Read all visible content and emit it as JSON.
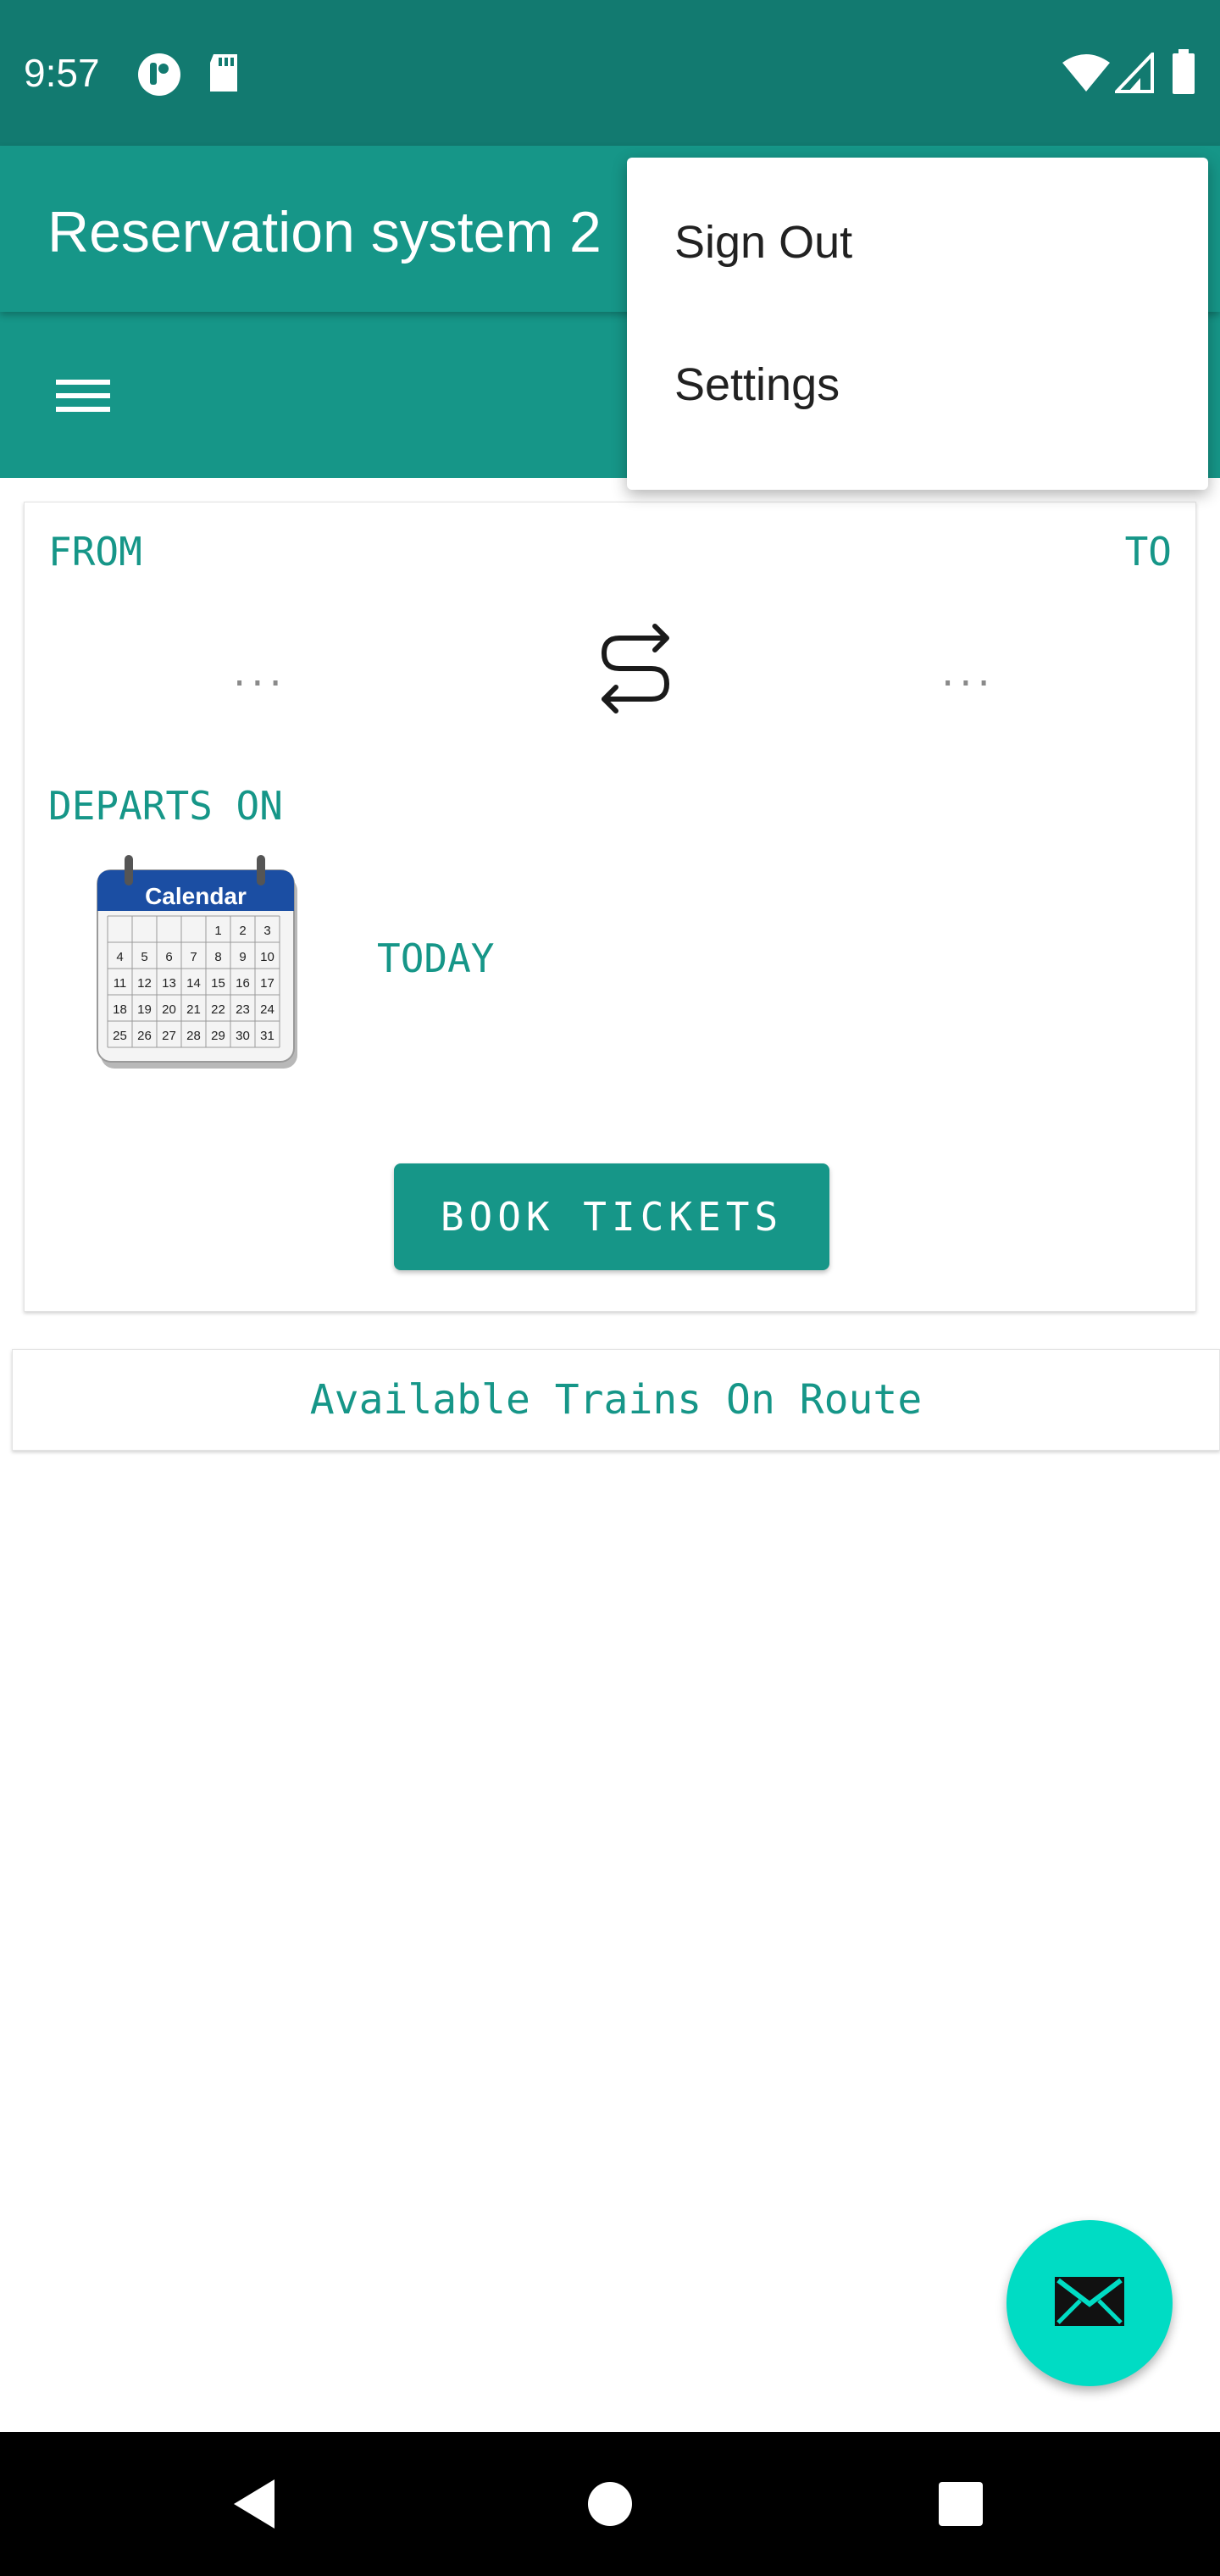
{
  "status_bar": {
    "time": "9:57",
    "icons": [
      "notification-app-icon",
      "sd-card-icon",
      "wifi-icon",
      "cell-signal-icon",
      "battery-icon"
    ]
  },
  "app_bar": {
    "title": "Reservation system 2"
  },
  "toolbar": {
    "menu_icon": "hamburger-menu-icon"
  },
  "overflow_menu": {
    "items": [
      {
        "label": "Sign Out"
      },
      {
        "label": "Settings"
      }
    ]
  },
  "booking_card": {
    "from_label": "FROM",
    "to_label": "TO",
    "from_value": "...",
    "to_value": "...",
    "swap_icon": "swap-route-icon",
    "departs_label": "DEPARTS ON",
    "calendar_icon": "calendar-icon",
    "calendar_caption": "Calendar",
    "calendar_days": [
      "1",
      "2",
      "3",
      "4",
      "5",
      "6",
      "7",
      "8",
      "9",
      "10",
      "11",
      "12",
      "13",
      "14",
      "15",
      "16",
      "17",
      "18",
      "19",
      "20",
      "21",
      "22",
      "23",
      "24",
      "25",
      "26",
      "27",
      "28",
      "29",
      "30",
      "31"
    ],
    "date_value": "TODAY",
    "book_button": "BOOK TICKETS"
  },
  "route_card": {
    "label": "Available Trains On Route"
  },
  "fab": {
    "icon": "mail-icon"
  },
  "nav_bar": {
    "icons": [
      "back-icon",
      "home-icon",
      "recents-icon"
    ]
  },
  "colors": {
    "status_bar": "#127a70",
    "primary": "#169688",
    "fab": "#00dcc4",
    "nav_bar": "#000000",
    "text_dark": "#212121"
  }
}
